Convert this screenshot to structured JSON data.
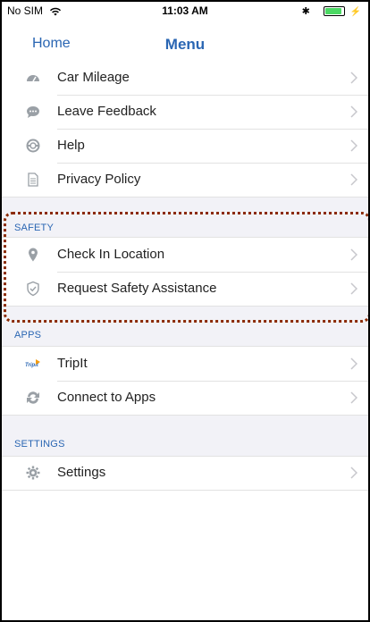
{
  "status": {
    "carrier": "No SIM",
    "time": "11:03 AM"
  },
  "nav": {
    "back_label": "Home",
    "title": "Menu"
  },
  "menu": {
    "items": [
      {
        "label": "Car Mileage",
        "icon": "speedometer-icon"
      },
      {
        "label": "Leave Feedback",
        "icon": "chat-bubble-icon"
      },
      {
        "label": "Help",
        "icon": "lifebuoy-icon"
      },
      {
        "label": "Privacy Policy",
        "icon": "document-icon"
      }
    ]
  },
  "safety": {
    "header": "SAFETY",
    "items": [
      {
        "label": "Check In Location",
        "icon": "location-pin-icon"
      },
      {
        "label": "Request Safety Assistance",
        "icon": "shield-check-icon"
      }
    ]
  },
  "apps": {
    "header": "APPS",
    "items": [
      {
        "label": "TripIt",
        "icon": "tripit-logo-icon",
        "logo_text": "TripIt"
      },
      {
        "label": "Connect to Apps",
        "icon": "connect-apps-icon"
      }
    ]
  },
  "settings": {
    "header": "SETTINGS",
    "items": [
      {
        "label": "Settings",
        "icon": "gear-icon"
      }
    ]
  },
  "colors": {
    "accent": "#2a66b3",
    "icon_gray": "#9aa0a6",
    "highlight": "#8b2a00"
  }
}
